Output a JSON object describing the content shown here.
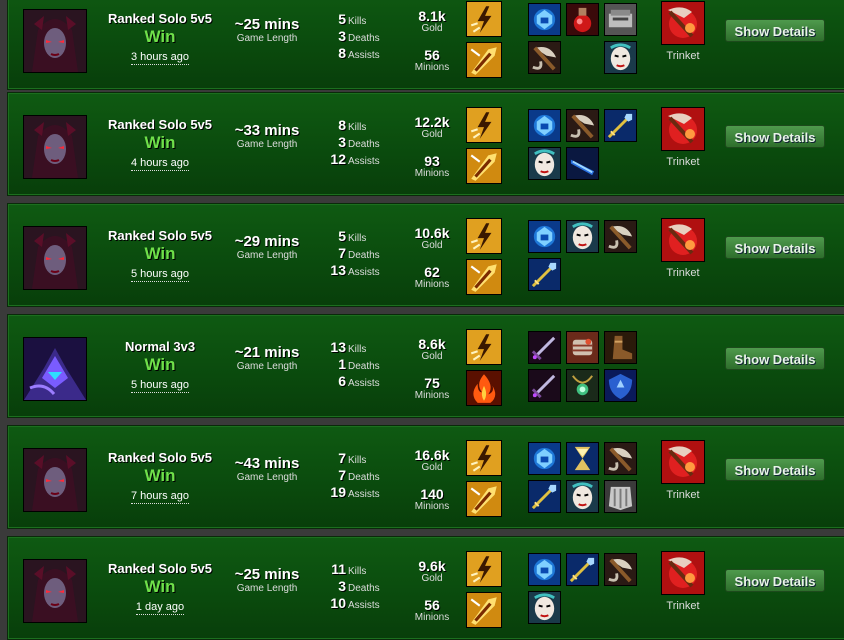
{
  "details_label": "Show Details",
  "trinket_label": "Trinket",
  "labels": {
    "game_length": "Game Length",
    "kills": "Kills",
    "deaths": "Deaths",
    "assists": "Assists",
    "gold": "Gold",
    "minions": "Minions"
  },
  "matches": [
    {
      "mode": "Ranked Solo 5v5",
      "result": "Win",
      "ago": "3 hours ago",
      "length": "~25 mins",
      "kills": "5",
      "deaths": "3",
      "assists": "8",
      "gold": "8.1k",
      "minions": "56",
      "champion_icon": "evelynn-icon",
      "spells": [
        "flash-icon",
        "smite-icon"
      ],
      "items": [
        "sightstone-icon",
        "health-potion-icon",
        "tool-icon",
        "axe-icon",
        "",
        "mask-icon"
      ],
      "has_trinket": true
    },
    {
      "mode": "Ranked Solo 5v5",
      "result": "Win",
      "ago": "4 hours ago",
      "length": "~33 mins",
      "kills": "8",
      "deaths": "3",
      "assists": "12",
      "gold": "12.2k",
      "minions": "93",
      "champion_icon": "evelynn-icon",
      "spells": [
        "flash-icon",
        "smite-icon"
      ],
      "items": [
        "sightstone-icon",
        "axe-icon",
        "spear-icon",
        "mask-icon",
        "blade-icon",
        ""
      ],
      "has_trinket": true
    },
    {
      "mode": "Ranked Solo 5v5",
      "result": "Win",
      "ago": "5 hours ago",
      "length": "~29 mins",
      "kills": "5",
      "deaths": "7",
      "assists": "13",
      "gold": "10.6k",
      "minions": "62",
      "champion_icon": "evelynn-icon",
      "spells": [
        "flash-icon",
        "smite-icon"
      ],
      "items": [
        "sightstone-icon",
        "mask-icon",
        "axe-icon",
        "spear-icon",
        "",
        ""
      ],
      "has_trinket": true
    },
    {
      "mode": "Normal 3v3",
      "result": "Win",
      "ago": "5 hours ago",
      "length": "~21 mins",
      "kills": "13",
      "deaths": "1",
      "assists": "6",
      "gold": "8.6k",
      "minions": "75",
      "champion_icon": "kassadin-icon",
      "spells": [
        "flash-icon",
        "ignite-icon"
      ],
      "items": [
        "sword-icon",
        "gauntlet-icon",
        "boots-icon",
        "sword-icon",
        "amulet-icon",
        "shield-icon"
      ],
      "has_trinket": false
    },
    {
      "mode": "Ranked Solo 5v5",
      "result": "Win",
      "ago": "7 hours ago",
      "length": "~43 mins",
      "kills": "7",
      "deaths": "7",
      "assists": "19",
      "gold": "16.6k",
      "minions": "140",
      "champion_icon": "evelynn-icon",
      "spells": [
        "flash-icon",
        "smite-icon"
      ],
      "items": [
        "sightstone-icon",
        "hourglass-icon",
        "axe-icon",
        "spear-icon",
        "mask-icon",
        "armor-icon"
      ],
      "has_trinket": true
    },
    {
      "mode": "Ranked Solo 5v5",
      "result": "Win",
      "ago": "1 day ago",
      "length": "~25 mins",
      "kills": "11",
      "deaths": "3",
      "assists": "10",
      "gold": "9.6k",
      "minions": "56",
      "champion_icon": "evelynn-icon",
      "spells": [
        "flash-icon",
        "smite-icon"
      ],
      "items": [
        "sightstone-icon",
        "spear-icon",
        "axe-icon",
        "mask-icon",
        "",
        ""
      ],
      "has_trinket": true
    }
  ]
}
